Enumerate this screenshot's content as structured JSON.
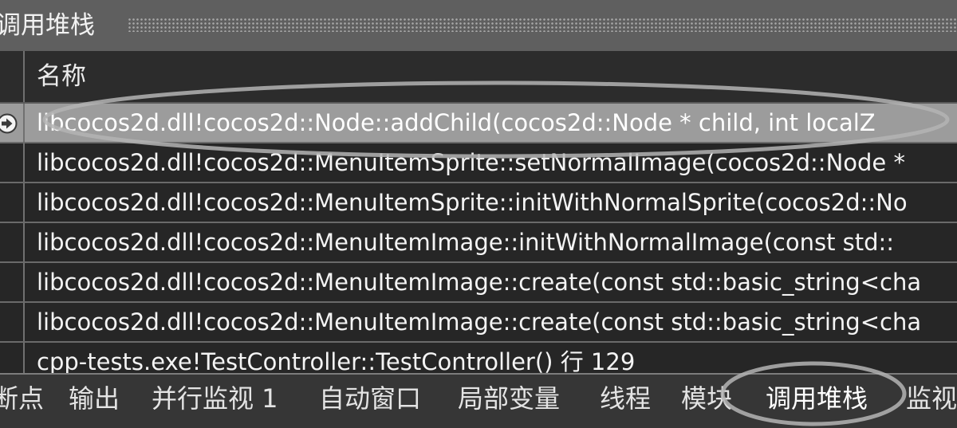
{
  "window": {
    "title": "调用堆栈"
  },
  "columns": {
    "name_header": "名称"
  },
  "frames": [
    {
      "text": "libcocos2d.dll!cocos2d::Node::addChild(cocos2d::Node * child, int localZ",
      "current": true,
      "icon": "current-frame-arrow-icon"
    },
    {
      "text": "libcocos2d.dll!cocos2d::MenuItemSprite::setNormalImage(cocos2d::Node *",
      "current": false
    },
    {
      "text": "libcocos2d.dll!cocos2d::MenuItemSprite::initWithNormalSprite(cocos2d::No",
      "current": false
    },
    {
      "text": "libcocos2d.dll!cocos2d::MenuItemImage::initWithNormalImage(const std::",
      "current": false
    },
    {
      "text": "libcocos2d.dll!cocos2d::MenuItemImage::create(const std::basic_string<cha",
      "current": false
    },
    {
      "text": "libcocos2d.dll!cocos2d::MenuItemImage::create(const std::basic_string<cha",
      "current": false
    },
    {
      "text": "cpp-tests.exe!TestController::TestController() 行 129",
      "current": false
    }
  ],
  "tabs": [
    {
      "label": "断点",
      "active": false
    },
    {
      "label": "输出",
      "active": false
    },
    {
      "label": "并行监视 1",
      "active": false
    },
    {
      "label": "自动窗口",
      "active": false
    },
    {
      "label": "局部变量",
      "active": false
    },
    {
      "label": "线程",
      "active": false
    },
    {
      "label": "模块",
      "active": false
    },
    {
      "label": "调用堆栈",
      "active": true
    },
    {
      "label": "监视",
      "active": false
    }
  ],
  "theme": {
    "title_bg": "#5f5f5f",
    "current_row_bg": "#9c9c9c",
    "list_bg": "#262626",
    "tabbar_bg": "#363636",
    "annotation": "#b4b4b4"
  }
}
